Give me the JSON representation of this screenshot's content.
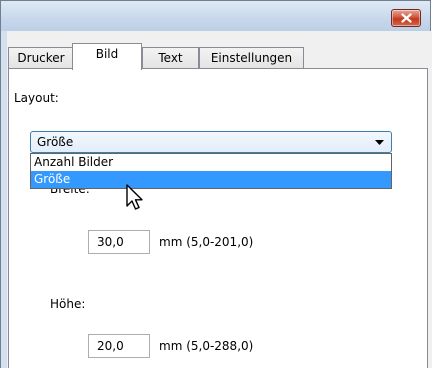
{
  "window": {
    "close_icon": "close-x-icon",
    "close_color": "#c2381e"
  },
  "tabs": [
    {
      "label": "Drucker",
      "active": false
    },
    {
      "label": "Bild",
      "active": true
    },
    {
      "label": "Text",
      "active": false
    },
    {
      "label": "Einstellungen",
      "active": false
    }
  ],
  "layout": {
    "label": "Layout:",
    "selected": "Größe",
    "options": [
      "Anzahl Bilder",
      "Größe"
    ],
    "highlighted_option": "Größe"
  },
  "breite": {
    "label": "Breite:",
    "value": "30,0",
    "range": "mm (5,0-201,0)"
  },
  "hoehe": {
    "label": "Höhe:",
    "value": "20,0",
    "range": "mm (5,0-288,0)"
  },
  "colors": {
    "selection": "#3399ff",
    "combo_border": "#3c7fb1"
  }
}
